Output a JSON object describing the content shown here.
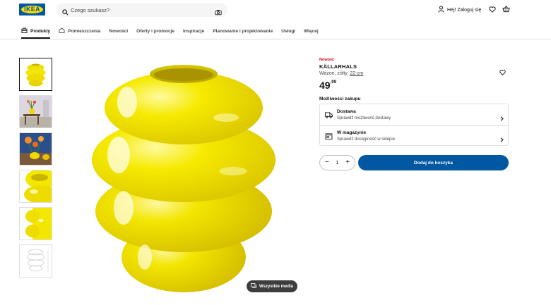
{
  "header": {
    "logo_text": "IKEA",
    "search": {
      "placeholder": "Czego szukasz?"
    },
    "login_label": "Hej! Zaloguj się"
  },
  "nav": {
    "items": [
      {
        "label": "Produkty",
        "icon": "shop-icon"
      },
      {
        "label": "Pomieszczenia",
        "icon": "home-icon"
      },
      {
        "label": "Nowości"
      },
      {
        "label": "Oferty i promocje"
      },
      {
        "label": "Inspiracje"
      },
      {
        "label": "Planowanie i projektowanie"
      },
      {
        "label": "Usługi"
      },
      {
        "label": "Więcej"
      }
    ]
  },
  "gallery": {
    "all_media_label": "Wszystkie media",
    "thumbnail_count": 6
  },
  "product": {
    "badge": "Nowość",
    "name": "KÄLLARHALS",
    "description_prefix": "Wazon, żółty, ",
    "description_size": "22 cm",
    "price_int": "49",
    "price_dec": ",99",
    "purchase_options_title": "Możliwości zakupu",
    "options": [
      {
        "title": "Dostawa",
        "subtitle": "Sprawdź możliwość dostawy",
        "icon": "truck-icon"
      },
      {
        "title": "W magazynie",
        "subtitle": "Sprawdź dostępność w sklepie",
        "icon": "store-icon"
      }
    ],
    "quantity": "1",
    "add_to_cart_label": "Dodaj do koszyka"
  },
  "colors": {
    "brand_blue": "#0058a3",
    "brand_yellow": "#ffdb00",
    "new_red": "#cc0008",
    "vase_yellow": "#f3e600"
  }
}
